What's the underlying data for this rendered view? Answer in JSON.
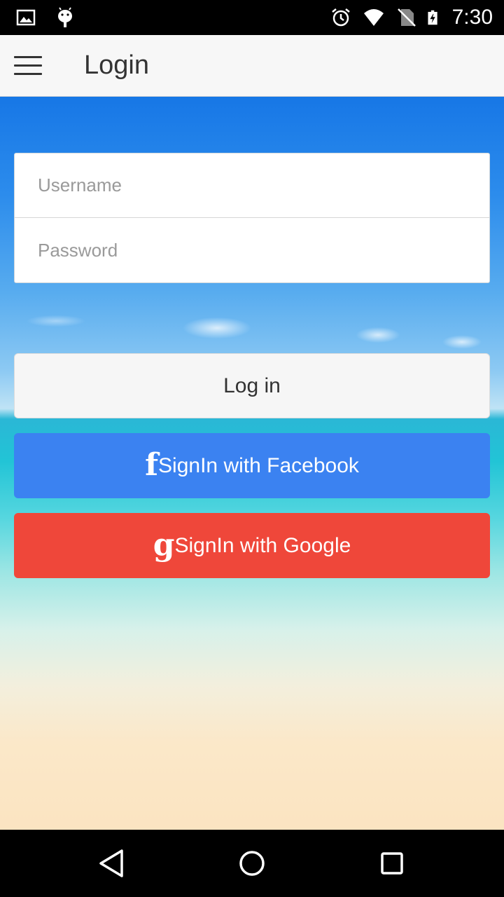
{
  "status_bar": {
    "time": "7:30",
    "left_icons": [
      "image-icon",
      "android-icon"
    ],
    "right_icons": [
      "alarm-icon",
      "wifi-icon",
      "no-sim-icon",
      "battery-charging-icon"
    ]
  },
  "app_bar": {
    "title": "Login",
    "menu_icon": "hamburger-menu-icon"
  },
  "form": {
    "username": {
      "placeholder": "Username",
      "value": ""
    },
    "password": {
      "placeholder": "Password",
      "value": ""
    }
  },
  "buttons": {
    "login": "Log in",
    "facebook": {
      "icon": "f",
      "label": "SignIn with Facebook",
      "color": "#3b82f1"
    },
    "google": {
      "icon": "g",
      "label": "SignIn with Google",
      "color": "#ef473a"
    }
  },
  "nav_bar": {
    "icons": [
      "back-icon",
      "home-icon",
      "recent-apps-icon"
    ]
  }
}
